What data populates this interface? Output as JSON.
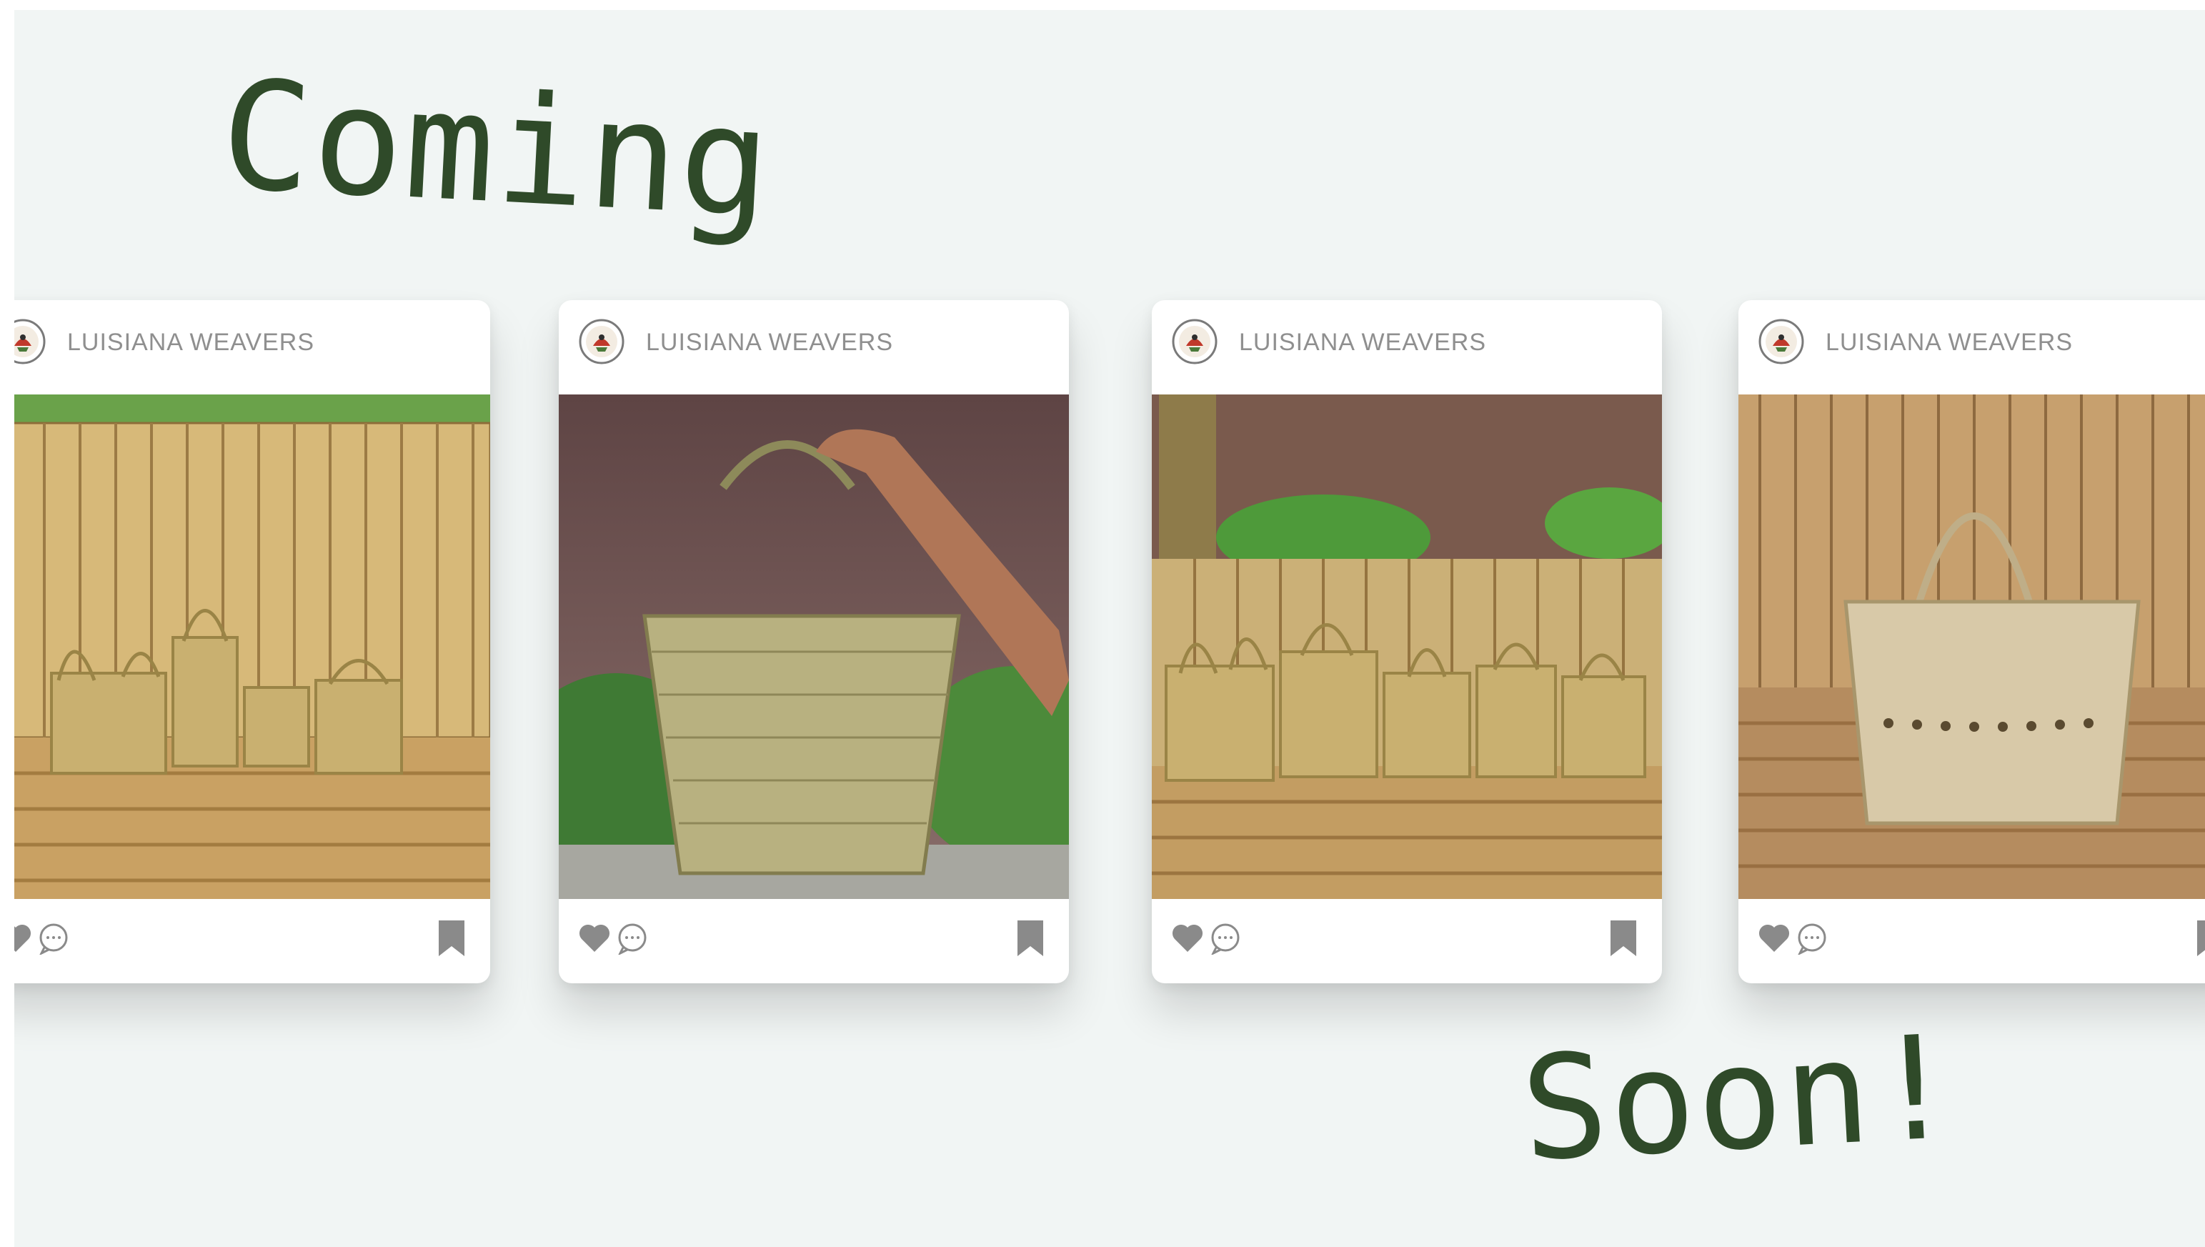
{
  "headline": {
    "top": "Coming",
    "bottom": "Soon!"
  },
  "cards": [
    {
      "brand": "LUISIANA WEAVERS"
    },
    {
      "brand": "LUISIANA WEAVERS"
    },
    {
      "brand": "LUISIANA WEAVERS"
    },
    {
      "brand": "LUISIANA WEAVERS"
    }
  ],
  "colors": {
    "background": "#f1f5f4",
    "headline": "#2f4a29",
    "icon": "#8a8a8a"
  }
}
